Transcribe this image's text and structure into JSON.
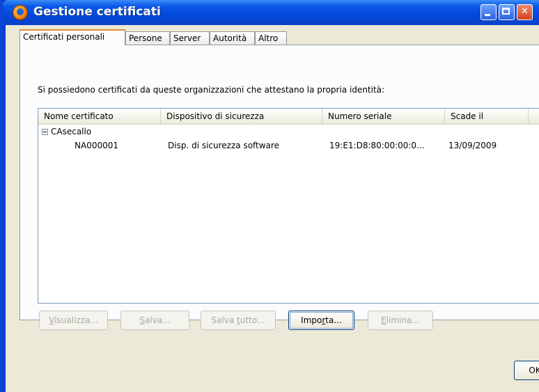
{
  "window": {
    "title": "Gestione certificati",
    "controls": [
      "minimize-icon",
      "maximize-icon",
      "close-icon"
    ]
  },
  "tabs": [
    {
      "label": "Certificati personali",
      "active": true
    },
    {
      "label": "Persone",
      "active": false
    },
    {
      "label": "Server",
      "active": false
    },
    {
      "label": "Autorità",
      "active": false
    },
    {
      "label": "Altro",
      "active": false
    }
  ],
  "description": "Si possiedono certificati da queste organizzazioni che attestano la propria identità:",
  "table": {
    "columns": [
      "Nome certificato",
      "Dispositivo di sicurezza",
      "Numero seriale",
      "Scade il"
    ],
    "group": {
      "name": "CAsecallo",
      "expanded": true
    },
    "rows": [
      {
        "nome": "NA000001",
        "dispositivo": "Disp. di sicurezza software",
        "seriale": "19:E1:D8:80:00:00:0...",
        "scade": "13/09/2009"
      }
    ]
  },
  "buttons": {
    "visualizza": {
      "pre": "",
      "mn": "V",
      "post": "isualizza..."
    },
    "salva": {
      "pre": "",
      "mn": "S",
      "post": "alva..."
    },
    "salva_tutto": {
      "pre": "Salva ",
      "mn": "t",
      "post": "utto..."
    },
    "importa": {
      "pre": "Impo",
      "mn": "r",
      "post": "ta..."
    },
    "elimina": {
      "pre": "",
      "mn": "E",
      "post": "limina..."
    },
    "ok": "OK"
  },
  "colors": {
    "titlebar": "#0a58e8",
    "dialog_background": "#ece9d8",
    "active_tab_accent": "#e68b2c"
  }
}
